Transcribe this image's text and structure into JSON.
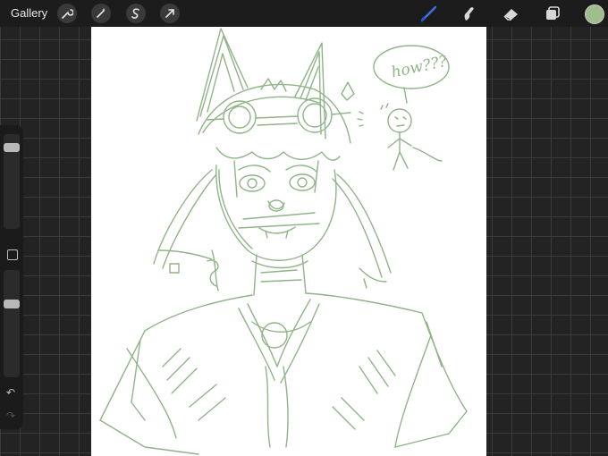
{
  "topbar": {
    "gallery_label": "Gallery",
    "left_tools": [
      "wrench-icon",
      "magic-wand-icon",
      "selection-icon",
      "transform-arrow-icon"
    ],
    "right_tools": [
      "brush-icon",
      "smudge-icon",
      "eraser-icon",
      "layers-icon"
    ],
    "active_tool": "brush",
    "accent_color": "#3f6fe8",
    "current_color": "#9dbf8c"
  },
  "sidebar": {
    "brush_size_level": 0.9,
    "opacity_level": 0.7,
    "modifier_label": "modifier-square-icon",
    "undo_icon": "undo-icon",
    "redo_icon": "redo-icon"
  },
  "canvas": {
    "background": "#ffffff",
    "stroke_color": "#8fb487",
    "speech_bubble_text": "how???"
  }
}
